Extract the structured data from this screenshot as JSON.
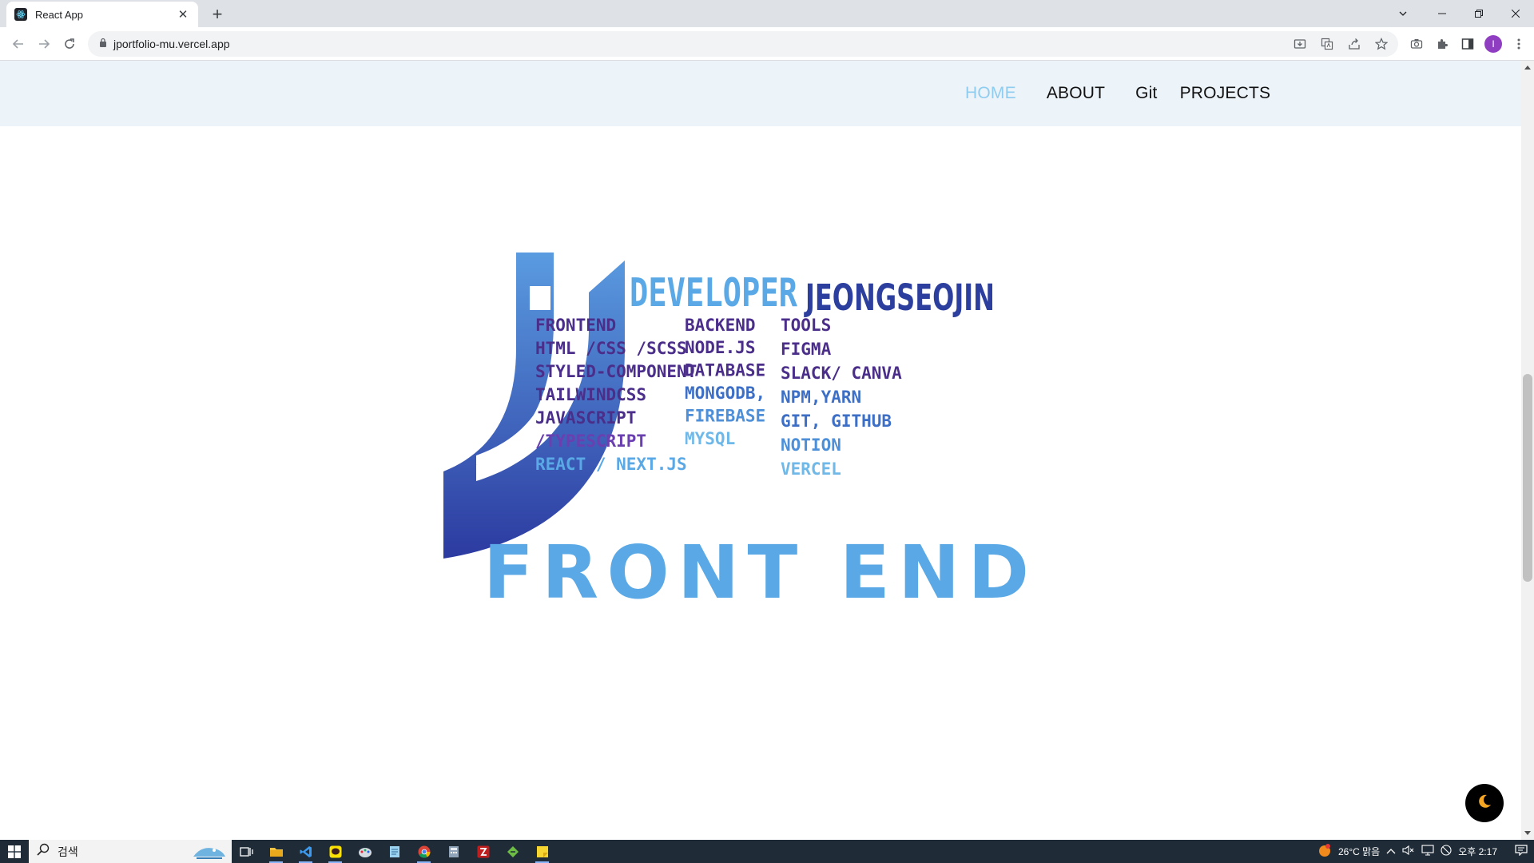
{
  "browser": {
    "tab_title": "React App",
    "close_glyph": "✕",
    "new_tab_glyph": "+",
    "url": "jportfolio-mu.vercel.app",
    "profile_initial": "I"
  },
  "site": {
    "nav": {
      "home": "HOME",
      "about": "ABOUT",
      "git": "Git",
      "projects": "PROJECTS",
      "active_color": "#8fcdf0"
    },
    "hero": {
      "word_developer": "DEVELOPER",
      "word_name": "JEONGSEOJIN",
      "frontend_heading": "FRONTEND",
      "frontend_items": [
        "HTML /CSS /SCSS",
        "STYLED-COMPONENT",
        "TAILWINDCSS",
        "JAVASCRIPT",
        "/TYPESCRIPT",
        "REACT / NEXT.JS"
      ],
      "backend_heading": "BACKEND",
      "backend_items": [
        "NODE.JS",
        "DATABASE",
        "MONGODB,",
        "FIREBASE",
        "MYSQL"
      ],
      "tools_heading": "TOOLS",
      "tools_items": [
        "FIGMA",
        "SLACK/ CANVA",
        "NPM,YARN",
        "GIT, GITHUB",
        "NOTION",
        "VERCEL"
      ],
      "tagline": "FRONT END",
      "colors": {
        "light_blue": "#5aa9e6",
        "dark_blue": "#2c3e9e",
        "purple": "#4a2e8a"
      }
    },
    "mode_toggle_icon": "moon-icon"
  },
  "taskbar": {
    "search_placeholder": "검색",
    "weather": "26°C 맑음",
    "time": "오후 2:17"
  }
}
